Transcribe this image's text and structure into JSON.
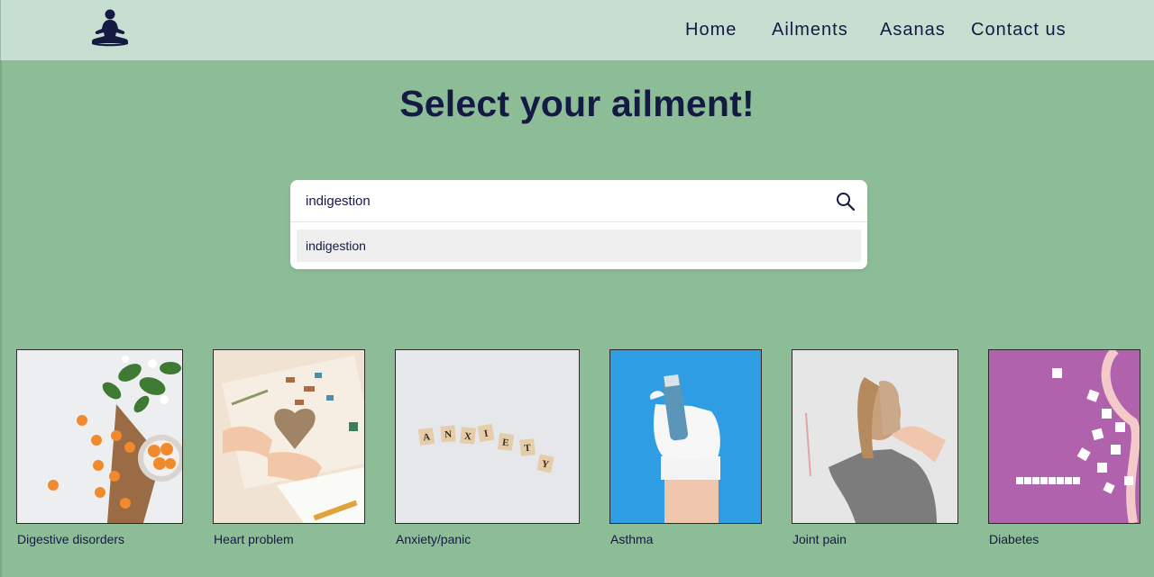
{
  "nav": {
    "logo_icon": "meditation-icon",
    "links": [
      "Home",
      "Ailments",
      "Asanas",
      "Contact us"
    ]
  },
  "main": {
    "title": "Select your ailment!",
    "search": {
      "value": "indigestion",
      "icon": "search-icon",
      "suggestions": [
        "indigestion"
      ]
    }
  },
  "ailments": [
    {
      "label": "Digestive disorders",
      "image": "apricots-in-bowl-photo"
    },
    {
      "label": "Heart problem",
      "image": "hands-holding-heart-photo"
    },
    {
      "label": "Anxiety/panic",
      "image": "anxiety-letter-tiles-photo"
    },
    {
      "label": "Asthma",
      "image": "gloved-hand-inhaler-photo"
    },
    {
      "label": "Joint pain",
      "image": "woman-holding-shoulder-photo"
    },
    {
      "label": "Diabetes",
      "image": "sugar-cubes-tape-measure-photo"
    }
  ],
  "colors": {
    "navbar": "#c6dfd0",
    "background": "#8cbd96",
    "text": "#151a45"
  }
}
